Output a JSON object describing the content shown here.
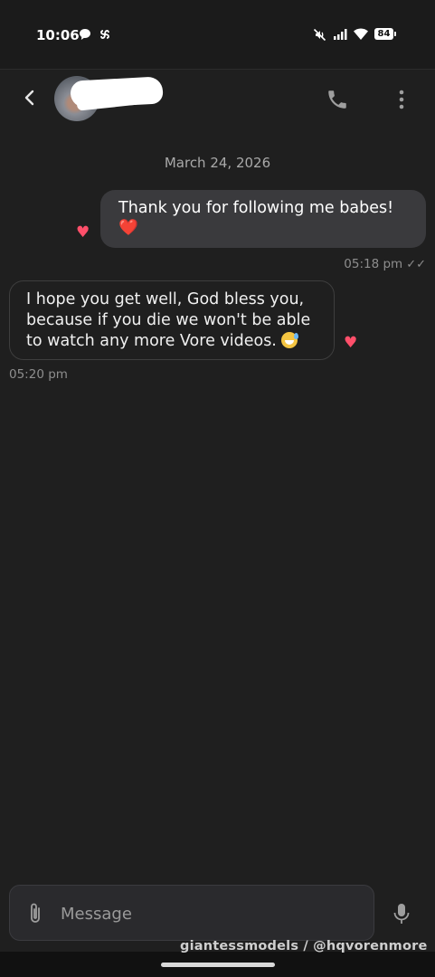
{
  "status_bar": {
    "time": "10:06",
    "battery": "84",
    "icons": [
      "chat-bubble-icon",
      "pinwheel-icon",
      "mute-icon",
      "signal-icon",
      "wifi-icon",
      "battery-icon"
    ]
  },
  "header": {
    "contact_name": "",
    "back_icon": "chevron-left-icon",
    "call_icon": "phone-icon",
    "menu_icon": "more-vertical-icon"
  },
  "conversation": {
    "date_separator": "March 24, 2026",
    "messages": [
      {
        "direction": "outgoing",
        "text": "Thank you for following me babes!",
        "emoji": "❤️",
        "time": "05:18 pm",
        "read_ticks": "✓✓",
        "reacted": true
      },
      {
        "direction": "incoming",
        "text": "I hope you get well, God bless you, because if you die we won't be able to watch any more Vore videos.",
        "emoji": "😅",
        "time": "05:20 pm",
        "reacted": true
      }
    ]
  },
  "composer": {
    "placeholder": "Message",
    "value": "",
    "attach_icon": "paperclip-icon",
    "mic_icon": "microphone-icon"
  },
  "watermark": "giantessmodels / @hqvorenmore",
  "colors": {
    "background": "#1f1f1f",
    "outgoing_bubble": "#3a3a3d",
    "reaction_heart": "#ff4f6a",
    "meta_text": "#8e8e8e"
  }
}
